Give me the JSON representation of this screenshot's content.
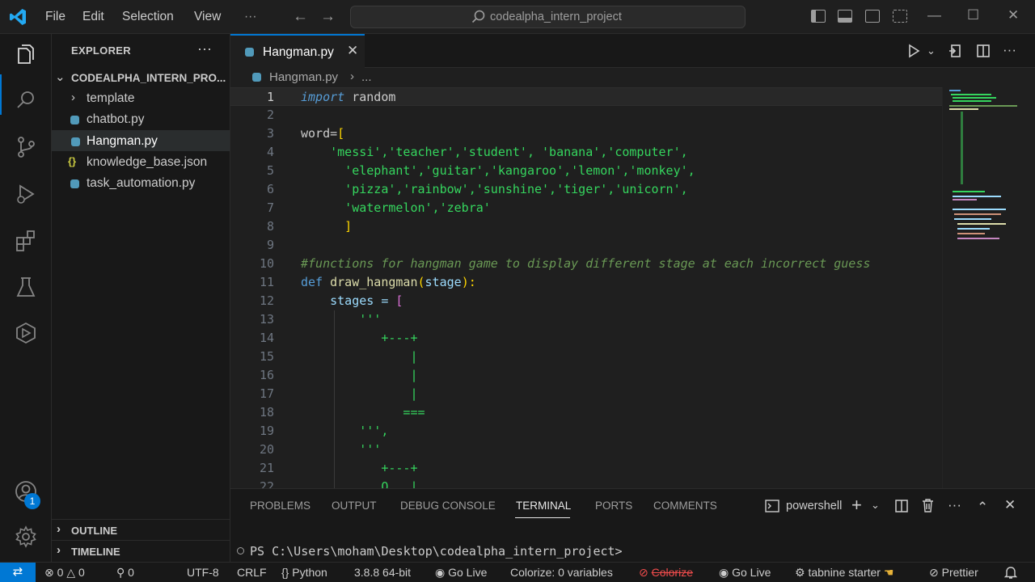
{
  "titlebar": {
    "menus": [
      "File",
      "Edit",
      "Selection",
      "View",
      "···"
    ],
    "search_text": "codealpha_intern_project",
    "back_icon": "←",
    "forward_icon": "→",
    "win_minimize": "—",
    "win_maximize": "☐",
    "win_close": "✕"
  },
  "explorer": {
    "title": "EXPLORER",
    "more": "···",
    "folder": "CODEALPHA_INTERN_PRO...",
    "items": [
      {
        "label": "template",
        "kind": "folder"
      },
      {
        "label": "chatbot.py",
        "kind": "py"
      },
      {
        "label": "Hangman.py",
        "kind": "py",
        "selected": true
      },
      {
        "label": "knowledge_base.json",
        "kind": "json"
      },
      {
        "label": "task_automation.py",
        "kind": "py"
      }
    ],
    "outline": "OUTLINE",
    "timeline": "TIMELINE",
    "json_glyph": "{}",
    "chevron_down": "⌄",
    "chevron_right": "›"
  },
  "activity": {
    "accounts_badge": "1"
  },
  "editor": {
    "tab_label": "Hangman.py",
    "tab_close": "✕",
    "breadcrumb_file": "Hangman.py",
    "breadcrumb_more": "...",
    "breadcrumb_sep": "›",
    "line_numbers": [
      "1",
      "2",
      "3",
      "4",
      "5",
      "6",
      "7",
      "8",
      "9",
      "10",
      "11",
      "12",
      "13",
      "14",
      "15",
      "16",
      "17",
      "18",
      "19",
      "20",
      "21",
      "22"
    ],
    "code": {
      "l1_kw": "import",
      "l1_rest": " random",
      "l3_a": "word=",
      "l3_b": "[",
      "l4": "    'messi','teacher','student', 'banana','computer',",
      "l5": "      'elephant','guitar','kangaroo','lemon','monkey',",
      "l6": "      'pizza','rainbow','sunshine','tiger','unicorn',",
      "l7": "      'watermelon','zebra'",
      "l8": "      ]",
      "l10": "#functions for hangman game to display different stage at each incorrect guess",
      "l11_kw": "def",
      "l11_fn": "draw_hangman",
      "l11_p1": "(",
      "l11_param": "stage",
      "l11_p2": "):",
      "l12_a": "    stages = ",
      "l12_b": "[",
      "l13": "        '''",
      "l14": "           +---+",
      "l15": "               |",
      "l16": "               |",
      "l17": "               |",
      "l18": "              ===",
      "l19": "        ''',",
      "l20": "        '''",
      "l21": "           +---+",
      "l22": "           O   |"
    }
  },
  "panel": {
    "tabs": [
      "PROBLEMS",
      "OUTPUT",
      "DEBUG CONSOLE",
      "TERMINAL",
      "PORTS",
      "COMMENTS"
    ],
    "active_tab": "TERMINAL",
    "shell": "powershell",
    "prompt": "PS C:\\Users\\moham\\Desktop\\codealpha_intern_project>",
    "add_icon": "+",
    "more": "···",
    "chevron_up": "⌃",
    "close": "✕"
  },
  "statusbar": {
    "remote": "⇄",
    "errors": "0",
    "warnings": "0",
    "ports": "0",
    "encoding": "UTF-8",
    "eol": "CRLF",
    "language": "Python",
    "interpreter": "3.8.8 64-bit",
    "go_live_1": "Go Live",
    "colorize_vars": "Colorize: 0 variables",
    "colorize": "Colorize",
    "go_live_2": "Go Live",
    "tabnine": "tabnine starter",
    "prettier": "Prettier"
  },
  "colors": {
    "accent": "#0078d4",
    "background": "#1f1f1f",
    "sidebar": "#181818",
    "string_green": "#35d65e"
  }
}
